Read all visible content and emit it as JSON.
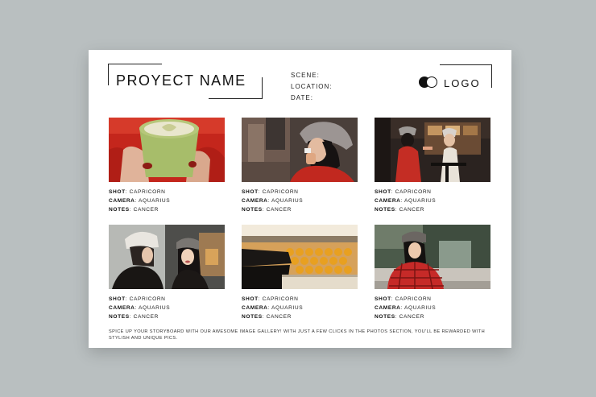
{
  "header": {
    "title": "PROYECT NAME",
    "scene_label": "SCENE:",
    "location_label": "LOCATION:",
    "date_label": "DATE:",
    "logo_text": "LOGO"
  },
  "caption_labels": {
    "shot": "SHOT",
    "camera": "CAMERA",
    "notes": "NOTES"
  },
  "cards": [
    {
      "photo": "matcha latte held in hands",
      "shot": ": CAPRICORN",
      "camera": ": AQUARIUS",
      "notes": ": CANCER"
    },
    {
      "photo": "woman in bucket hat eating",
      "shot": ": CAPRICORN",
      "camera": ": AQUARIUS",
      "notes": ": CANCER"
    },
    {
      "photo": "two women in cafe",
      "shot": ": CAPRICORN",
      "camera": ": AQUARIUS",
      "notes": ": CANCER"
    },
    {
      "photo": "two women in bucket hats",
      "shot": ": CAPRICORN",
      "camera": ": AQUARIUS",
      "notes": ": CANCER"
    },
    {
      "photo": "tray of pastries",
      "shot": ": CAPRICORN",
      "camera": ": AQUARIUS",
      "notes": ": CANCER"
    },
    {
      "photo": "woman in plaid jacket by canal",
      "shot": ": CAPRICORN",
      "camera": ": AQUARIUS",
      "notes": ": CANCER"
    }
  ],
  "footer_text": "SPICE UP YOUR STORYBOARD WITH OUR AWESOME IMAGE GALLERY! WITH JUST A FEW CLICKS IN THE PHOTOS SECTION, YOU'LL BE REWARDED WITH STYLISH AND UNIQUE PICS."
}
